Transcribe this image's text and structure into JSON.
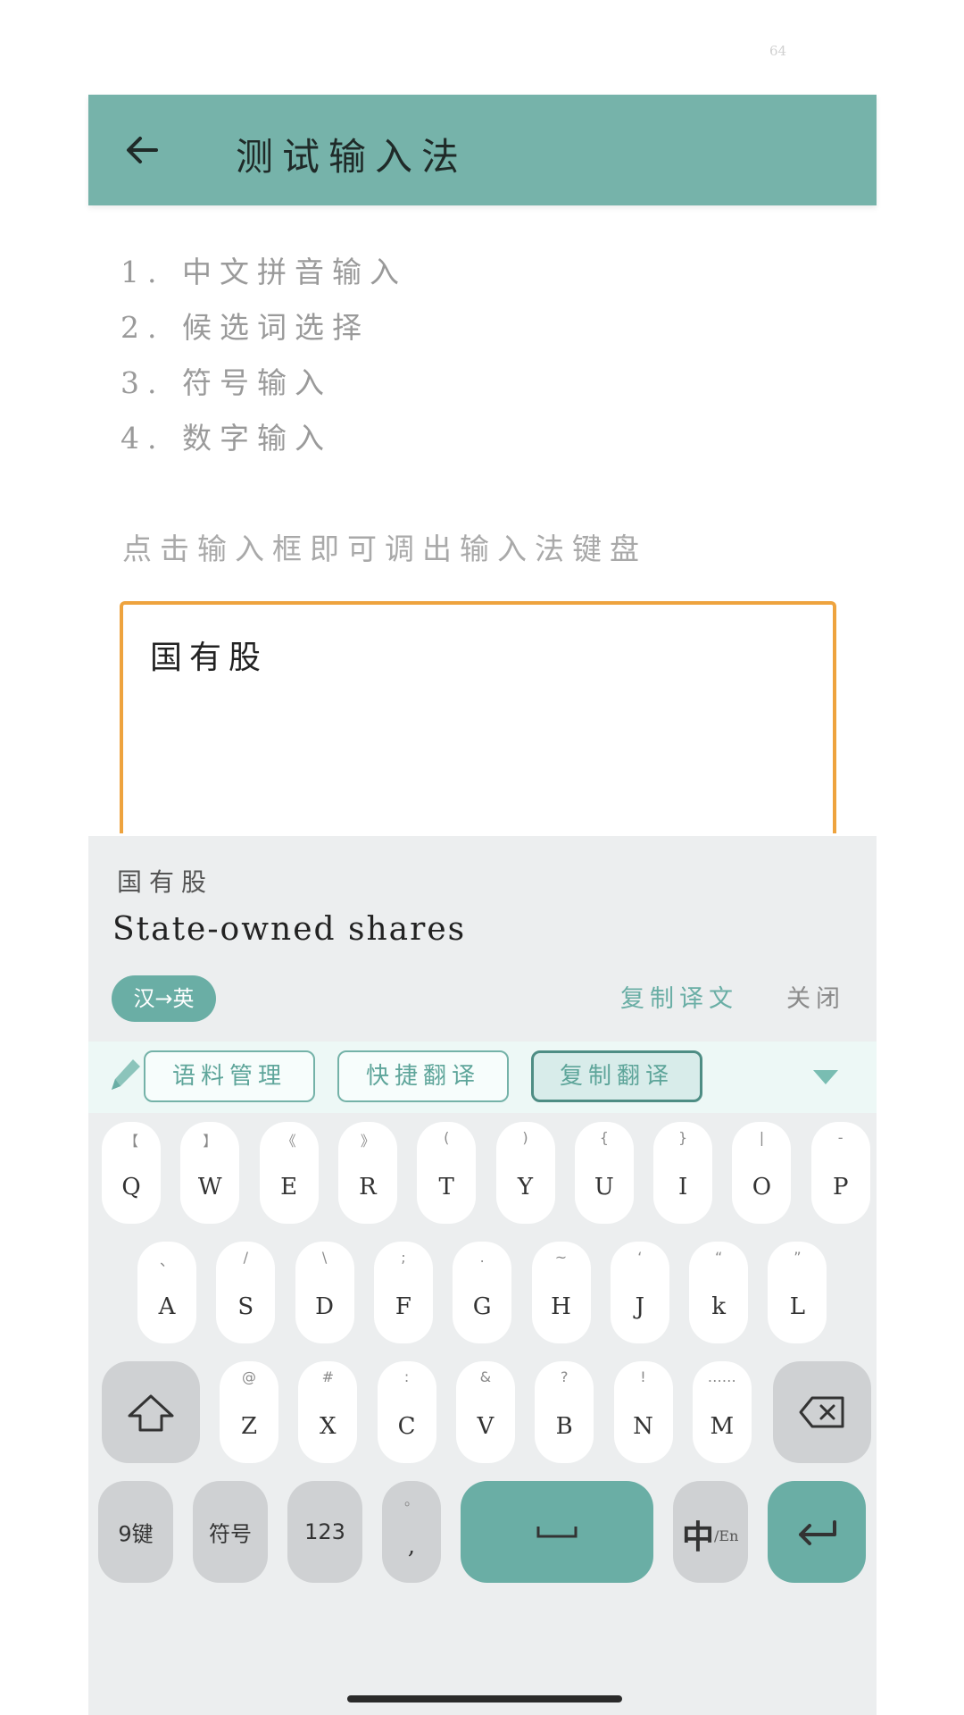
{
  "status": {
    "corner_number": "64"
  },
  "header": {
    "title": "测试输入法",
    "back_icon": "arrow-left-icon"
  },
  "features": [
    "1. 中文拼音输入",
    "2. 候选词选择",
    "3. 符号输入",
    "4. 数字输入"
  ],
  "hint": "点击输入框即可调出输入法键盘",
  "input": {
    "value": "国有股"
  },
  "translation": {
    "source": "国有股",
    "result": "State-owned shares",
    "direction": "汉→英",
    "copy_label": "复制译文",
    "close_label": "关闭"
  },
  "toolbar": {
    "pen_icon": "pen-icon",
    "buttons": [
      "语料管理",
      "快捷翻译",
      "复制翻译"
    ],
    "active_index": 2,
    "dropdown_icon": "chevron-down-icon"
  },
  "keyboard": {
    "row1": [
      {
        "main": "Q",
        "sub": "【"
      },
      {
        "main": "W",
        "sub": "】"
      },
      {
        "main": "E",
        "sub": "《"
      },
      {
        "main": "R",
        "sub": "》"
      },
      {
        "main": "T",
        "sub": "("
      },
      {
        "main": "Y",
        "sub": ")"
      },
      {
        "main": "U",
        "sub": "{"
      },
      {
        "main": "I",
        "sub": "}"
      },
      {
        "main": "O",
        "sub": "|"
      },
      {
        "main": "P",
        "sub": "-"
      }
    ],
    "row2": [
      {
        "main": "A",
        "sub": "、"
      },
      {
        "main": "S",
        "sub": "/"
      },
      {
        "main": "D",
        "sub": "\\"
      },
      {
        "main": "F",
        "sub": ";"
      },
      {
        "main": "G",
        "sub": "."
      },
      {
        "main": "H",
        "sub": "~"
      },
      {
        "main": "J",
        "sub": "‘"
      },
      {
        "main": "k",
        "sub": "“"
      },
      {
        "main": "L",
        "sub": "”"
      }
    ],
    "row3": [
      {
        "main": "Z",
        "sub": "@"
      },
      {
        "main": "X",
        "sub": "#"
      },
      {
        "main": "C",
        "sub": ":"
      },
      {
        "main": "V",
        "sub": "&"
      },
      {
        "main": "B",
        "sub": "?"
      },
      {
        "main": "N",
        "sub": "!"
      },
      {
        "main": "M",
        "sub": "……"
      }
    ],
    "shift_icon": "shift-arrow-icon",
    "backspace_icon": "backspace-icon",
    "nine_key": "9键",
    "symbols": "符号",
    "numbers": "123",
    "comma_main": ",",
    "comma_sub": "。",
    "space_icon": "space-icon",
    "lang_main": "中",
    "lang_sub": "/En",
    "enter_icon": "enter-icon"
  },
  "colors": {
    "header": "#76b3aa",
    "accent": "#6aaea5",
    "input_border": "#eea33e",
    "keyboard_bg": "#eceeef"
  }
}
